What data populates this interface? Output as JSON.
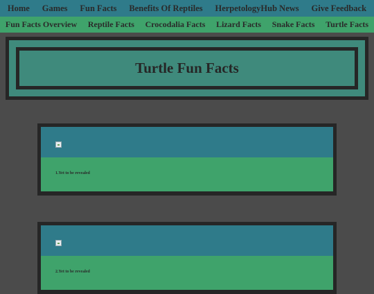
{
  "top_nav": {
    "items": [
      "Home",
      "Games",
      "Fun Facts",
      "Benefits Of Reptiles",
      "HerpetologyHub News",
      "Give Feedback"
    ]
  },
  "sub_nav": {
    "items": [
      "Fun Facts Overview",
      "Reptile Facts",
      "Crocodalia Facts",
      "Lizard Facts",
      "Snake Facts",
      "Turtle Facts"
    ]
  },
  "banner": {
    "title": "Turtle Fun Facts"
  },
  "facts": [
    {
      "image_icon": "broken-image-icon",
      "text": "1.Yet to be revealed"
    },
    {
      "image_icon": "broken-image-icon",
      "text": "2.Yet to be revealed"
    }
  ],
  "colors": {
    "background": "#4b4b4b",
    "top_nav": "#2f7b8a",
    "sub_nav": "#3fa36b",
    "card_border": "#262626",
    "banner_fill": "#3f8a7c"
  }
}
